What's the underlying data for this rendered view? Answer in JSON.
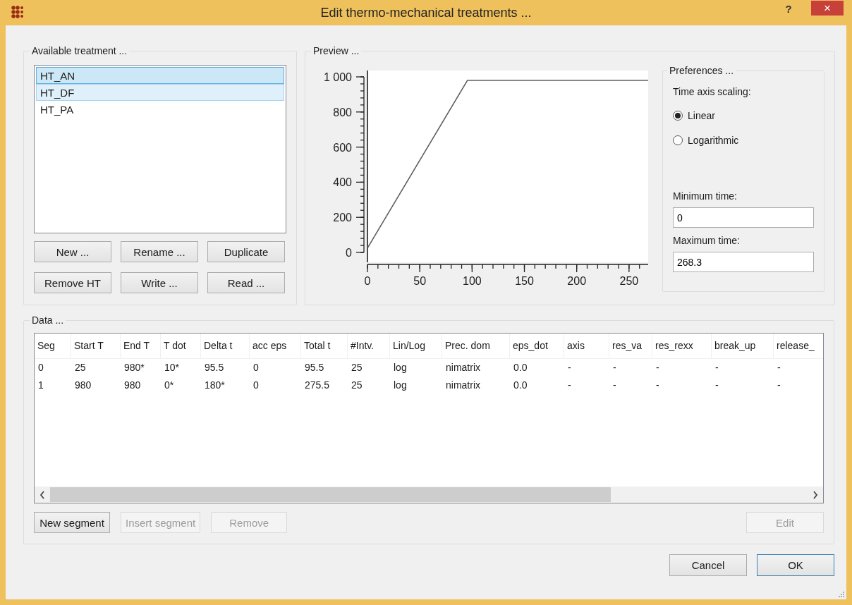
{
  "window": {
    "title": "Edit thermo-mechanical treatments ...",
    "help": "?",
    "close": "×"
  },
  "treatments": {
    "title": "Available treatment ...",
    "items": [
      {
        "label": "HT_AN",
        "selected": true,
        "focused": true
      },
      {
        "label": "HT_DF",
        "selected": true,
        "focused": false
      },
      {
        "label": "HT_PA",
        "selected": false,
        "focused": false
      }
    ],
    "buttons": [
      {
        "label": "New ..."
      },
      {
        "label": "Rename ..."
      },
      {
        "label": "Duplicate"
      },
      {
        "label": "Remove HT"
      },
      {
        "label": "Write ..."
      },
      {
        "label": "Read ..."
      }
    ]
  },
  "preview": {
    "title": "Preview ...",
    "chart_data": {
      "type": "line",
      "x": [
        0,
        95.5,
        268.3
      ],
      "series": [
        {
          "color": "#606060",
          "values": [
            25,
            980,
            980
          ]
        }
      ],
      "xlim": [
        0,
        268.3
      ],
      "ylim": [
        0,
        1000
      ],
      "xticks": [
        0,
        50,
        100,
        150,
        200,
        250
      ],
      "yticks": [
        0,
        200,
        400,
        600,
        800,
        {
          "value": 1000,
          "label": "1 000"
        }
      ]
    },
    "preferences": {
      "title": "Preferences ...",
      "scaling_label": "Time axis scaling:",
      "options": [
        {
          "label": "Linear",
          "selected": true
        },
        {
          "label": "Logarithmic",
          "selected": false
        }
      ],
      "min_label": "Minimum time:",
      "min_value": "0",
      "max_label": "Maximum time:",
      "max_value": "268.3"
    }
  },
  "data": {
    "title": "Data ...",
    "table": {
      "columns": [
        "Seg",
        "Start T",
        "End T",
        "T dot",
        "Delta t",
        "acc eps",
        "Total t",
        "#Intv.",
        "Lin/Log",
        "Prec. dom",
        "eps_dot",
        "axis",
        "res_va",
        "res_rexx",
        "break_up",
        "release_"
      ],
      "rows": [
        [
          "0",
          "25",
          "980*",
          "10*",
          "95.5",
          "0",
          "95.5",
          "25",
          "log",
          "nimatrix",
          "0.0",
          "-",
          "-",
          "-",
          "-",
          "-"
        ],
        [
          "1",
          "980",
          "980",
          "0*",
          "180*",
          "0",
          "275.5",
          "25",
          "log",
          "nimatrix",
          "0.0",
          "-",
          "-",
          "-",
          "-",
          "-"
        ]
      ]
    },
    "buttons": [
      {
        "label": "New segment",
        "disabled": false
      },
      {
        "label": "Insert segment",
        "disabled": true
      },
      {
        "label": "Remove",
        "disabled": true
      },
      {
        "label": "Edit",
        "disabled": true
      }
    ]
  },
  "dialog_buttons": [
    {
      "label": "Cancel",
      "default": false
    },
    {
      "label": "OK",
      "default": true
    }
  ]
}
